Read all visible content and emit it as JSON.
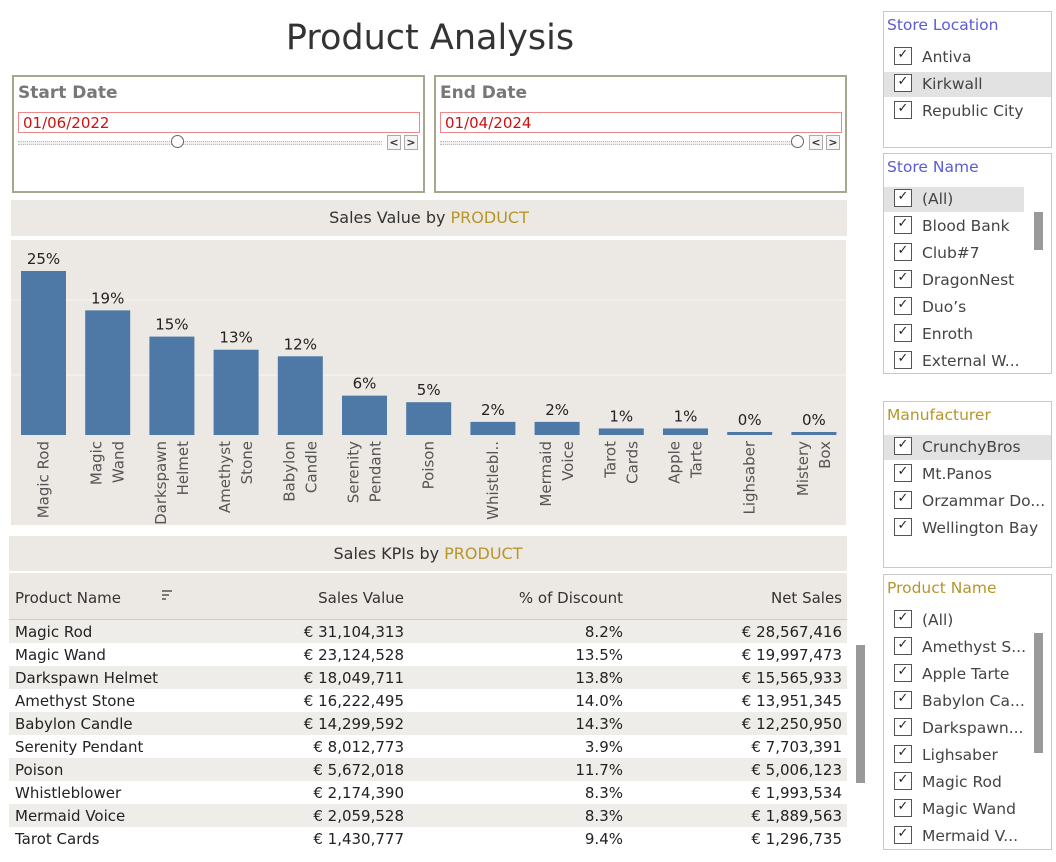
{
  "dashboard": {
    "title": "Product Analysis"
  },
  "start_date": {
    "label": "Start Date",
    "value": "01/06/2022"
  },
  "end_date": {
    "label": "End Date",
    "value": "01/04/2024"
  },
  "chart_header": {
    "prefix": "Sales Value by ",
    "accent": "PRODUCT"
  },
  "chart_data": {
    "type": "bar",
    "title": "Sales Value by PRODUCT",
    "categories": [
      [
        "Magic Rod"
      ],
      [
        "Magic",
        "Wand"
      ],
      [
        "Darkspawn",
        "Helmet"
      ],
      [
        "Amethyst",
        "Stone"
      ],
      [
        "Babylon",
        "Candle"
      ],
      [
        "Serenity",
        "Pendant"
      ],
      [
        "Poison"
      ],
      [
        "Whistlebl.."
      ],
      [
        "Mermaid",
        "Voice"
      ],
      [
        "Tarot",
        "Cards"
      ],
      [
        "Apple",
        "Tarte"
      ],
      [
        "Lighsaber"
      ],
      [
        "Mistery",
        "Box"
      ]
    ],
    "values": [
      25,
      19,
      15,
      13,
      12,
      6,
      5,
      2,
      2,
      1,
      1,
      0,
      0
    ],
    "labels": [
      "25%",
      "19%",
      "15%",
      "13%",
      "12%",
      "6%",
      "5%",
      "2%",
      "2%",
      "1%",
      "1%",
      "0%",
      "0%"
    ],
    "ylim": [
      0,
      25
    ],
    "bar_color": "#4e79a7"
  },
  "kpi_header": {
    "prefix": "Sales KPIs by ",
    "accent": "PRODUCT"
  },
  "kpi_table": {
    "columns": [
      "Product Name",
      "Sales Value",
      "% of Discount",
      "Net Sales"
    ],
    "sort_icon": "sort-icon",
    "rows": [
      [
        "Magic Rod",
        "€ 31,104,313",
        "8.2%",
        "€ 28,567,416"
      ],
      [
        "Magic Wand",
        "€ 23,124,528",
        "13.5%",
        "€ 19,997,473"
      ],
      [
        "Darkspawn Helmet",
        "€ 18,049,711",
        "13.8%",
        "€ 15,565,933"
      ],
      [
        "Amethyst Stone",
        "€ 16,222,495",
        "14.0%",
        "€ 13,951,345"
      ],
      [
        "Babylon Candle",
        "€ 14,299,592",
        "14.3%",
        "€ 12,250,950"
      ],
      [
        "Serenity Pendant",
        "€ 8,012,773",
        "3.9%",
        "€ 7,703,391"
      ],
      [
        "Poison",
        "€ 5,672,018",
        "11.7%",
        "€ 5,006,123"
      ],
      [
        "Whistleblower",
        "€ 2,174,390",
        "8.3%",
        "€ 1,993,534"
      ],
      [
        "Mermaid Voice",
        "€ 2,059,528",
        "8.3%",
        "€ 1,889,563"
      ],
      [
        "Tarot Cards",
        "€ 1,430,777",
        "9.4%",
        "€ 1,296,735"
      ]
    ]
  },
  "filters": {
    "store_location": {
      "title": "Store Location",
      "title_color": "#5b5bd6",
      "items": [
        "Antiva",
        "Kirkwall",
        "Republic City"
      ]
    },
    "store_name": {
      "title": "Store Name",
      "title_color": "#5b5bd6",
      "items": [
        "(All)",
        "Blood Bank",
        "Club#7",
        "DragonNest",
        "Duo’s",
        "Enroth",
        "External W..."
      ]
    },
    "manufacturer": {
      "title": "Manufacturer",
      "title_color": "#b8952a",
      "items": [
        "CrunchyBros",
        "Mt.Panos",
        "Orzammar Do...",
        "Wellington Bay"
      ]
    },
    "product_name": {
      "title": "Product Name",
      "title_color": "#b8952a",
      "items": [
        "(All)",
        "Amethyst S...",
        "Apple Tarte",
        "Babylon Ca...",
        "Darkspawn...",
        "Lighsaber",
        "Magic Rod",
        "Magic Wand",
        "Mermaid V..."
      ]
    }
  },
  "checkbox_mark": "✓"
}
